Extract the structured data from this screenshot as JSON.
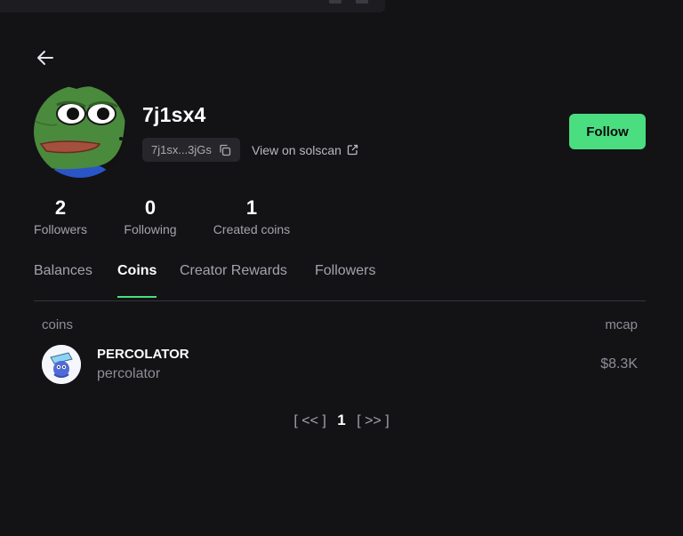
{
  "profile": {
    "username": "7j1sx4",
    "address_short": "7j1sx...3jGs",
    "solscan_label": "View on solscan",
    "follow_label": "Follow"
  },
  "stats": [
    {
      "value": "2",
      "label": "Followers"
    },
    {
      "value": "0",
      "label": "Following"
    },
    {
      "value": "1",
      "label": "Created coins"
    }
  ],
  "tabs": [
    {
      "label": "Balances",
      "active": false
    },
    {
      "label": "Coins",
      "active": true
    },
    {
      "label": "Creator Rewards",
      "active": false
    },
    {
      "label": "Followers",
      "active": false
    }
  ],
  "coins_table": {
    "headers": {
      "coins": "coins",
      "mcap": "mcap"
    },
    "rows": [
      {
        "name": "PERCOLATOR",
        "ticker": "percolator",
        "mcap": "$8.3K"
      }
    ]
  },
  "pagination": {
    "prev": "[ << ]",
    "current": "1",
    "next": "[ >> ]"
  },
  "icons": {
    "back": "arrow-left-icon",
    "copy": "copy-icon",
    "external": "external-link-icon"
  },
  "colors": {
    "background": "#131316",
    "accent": "#4ade80",
    "muted_text": "#a3a3ab"
  }
}
